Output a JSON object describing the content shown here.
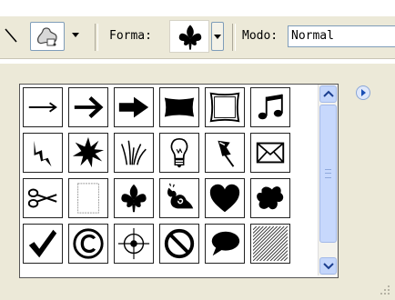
{
  "toolbar": {
    "forma_label": "Forma:",
    "modo_label": "Modo:",
    "modo_value": "Normal"
  },
  "shapes": {
    "rows": [
      [
        "arrow-thin",
        "arrow-medium",
        "arrow-bold",
        "banner",
        "frame",
        "music-notes"
      ],
      [
        "lightning",
        "starburst",
        "grass",
        "lightbulb",
        "thumbtack",
        "envelope"
      ],
      [
        "scissors",
        "blank-paper",
        "fleur-de-lis",
        "snail",
        "heart",
        "splat"
      ],
      [
        "checkmark",
        "copyright",
        "crosshair",
        "no-symbol",
        "speech-bubble",
        "diagonal-hatch"
      ]
    ],
    "selected": "fleur-de-lis"
  },
  "icons": {
    "tool": "line-tool-icon",
    "shape": "custom-shape-icon",
    "panel_menu": "panel-menu-icon"
  }
}
